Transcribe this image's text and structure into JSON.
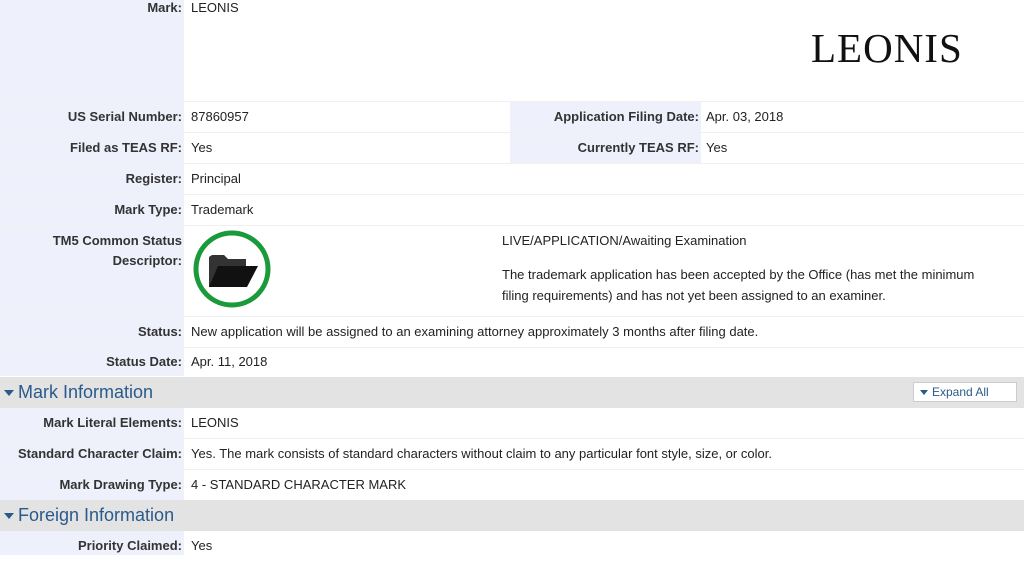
{
  "mark": {
    "label": "Mark:",
    "value": "LEONIS",
    "image_text": "LEONIS"
  },
  "serial": {
    "label": "US Serial Number:",
    "value": "87860957"
  },
  "filing_date": {
    "label": "Application Filing Date:",
    "value": "Apr. 03, 2018"
  },
  "teas_rf": {
    "label": "Filed as TEAS RF:",
    "value": "Yes"
  },
  "current_teas_rf": {
    "label": "Currently TEAS RF:",
    "value": "Yes"
  },
  "register": {
    "label": "Register:",
    "value": "Principal"
  },
  "mark_type": {
    "label": "Mark Type:",
    "value": "Trademark"
  },
  "tm5": {
    "label_line1": "TM5 Common Status",
    "label_line2": "Descriptor:",
    "status_title": "LIVE/APPLICATION/Awaiting Examination",
    "description_line1": "The trademark application has been accepted by the Office (has met the minimum",
    "description_line2": "filing requirements) and has not yet been assigned to an examiner.",
    "icon": "folder-icon",
    "ring_color": "#1a9a3a"
  },
  "status": {
    "label": "Status:",
    "value": "New application will be assigned to an examining attorney approximately 3 months after filing date."
  },
  "status_date": {
    "label": "Status Date:",
    "value": "Apr. 11, 2018"
  },
  "mark_info": {
    "title": "Mark Information",
    "expand_label": "Expand All",
    "literal": {
      "label": "Mark Literal Elements:",
      "value": "LEONIS"
    },
    "std_char": {
      "label": "Standard Character Claim:",
      "value": "Yes. The mark consists of standard characters without claim to any particular font style, size, or color."
    },
    "drawing": {
      "label": "Mark Drawing Type:",
      "value": "4 - STANDARD CHARACTER MARK"
    }
  },
  "foreign_info": {
    "title": "Foreign Information",
    "priority": {
      "label": "Priority Claimed:",
      "value": "Yes"
    }
  },
  "colors": {
    "label_bg": "#eef0fb",
    "section_bg": "#e3e3e3",
    "section_title": "#2a5a8c"
  }
}
